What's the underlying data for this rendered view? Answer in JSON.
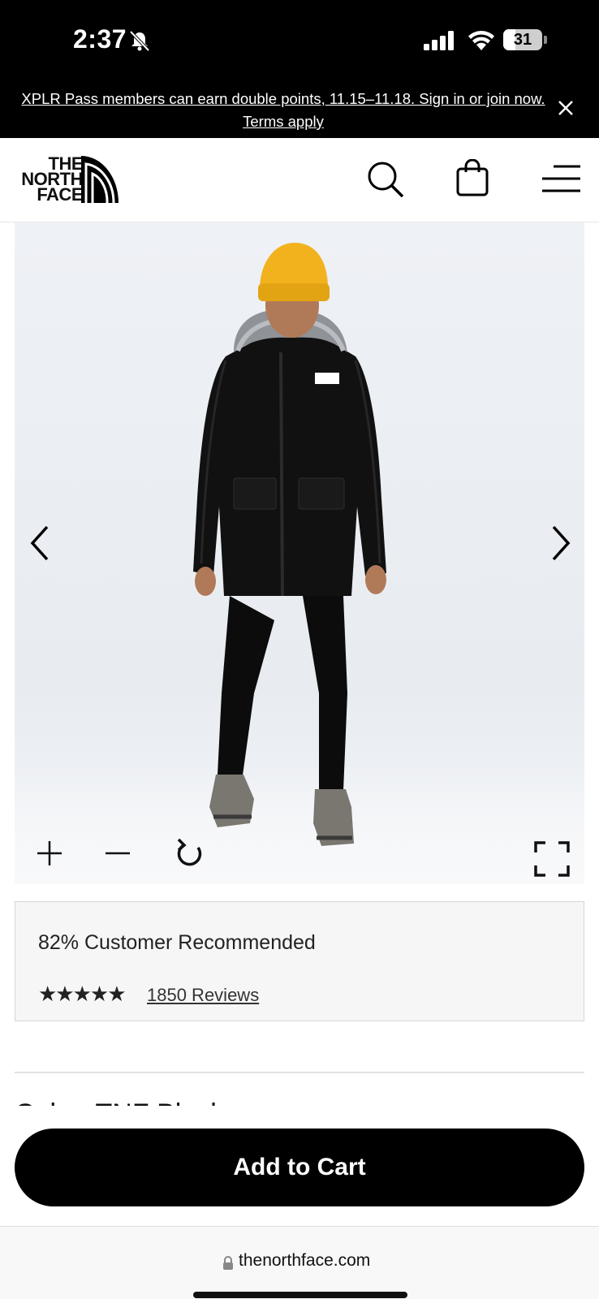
{
  "status_bar": {
    "time": "2:37",
    "battery": "31",
    "battery_level": 0.31
  },
  "promo": {
    "text": "XPLR Pass members can earn double points, 11.15–11.18. Sign in or join now. Terms apply"
  },
  "header": {
    "logo_lines": [
      "THE",
      "NORTH",
      "FACE"
    ]
  },
  "product": {
    "recommend_text": "82% Customer Recommended",
    "stars": "★★★★★",
    "rating": 5,
    "reviews_link": "1850 Reviews",
    "color_label_peek": "Color: TNF Black"
  },
  "cart": {
    "button_label": "Add to Cart"
  },
  "browser": {
    "url": "thenorthface.com"
  },
  "colors": {
    "brand_black": "#000000",
    "beanie_yellow": "#f2b21e"
  }
}
